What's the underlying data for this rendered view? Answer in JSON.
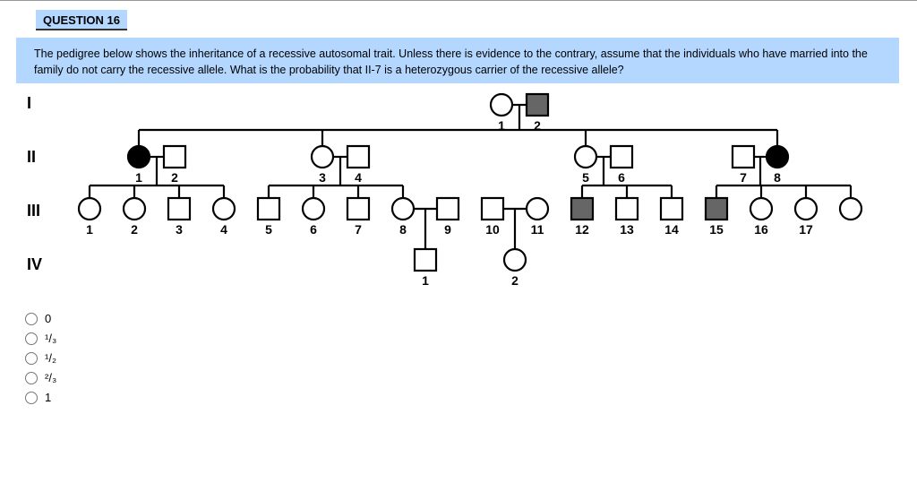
{
  "question": {
    "heading": "QUESTION 16",
    "text": "The pedigree below shows the inheritance of a recessive autosomal trait. Unless there is evidence to the contrary, assume that the individuals who have married into the family do not carry the recessive allele. What is the probability that II-7 is a heterozygous carrier of the recessive allele?"
  },
  "rows": {
    "r1": "I",
    "r2": "II",
    "r3": "III",
    "r4": "IV"
  },
  "people": {
    "i1": "1",
    "i2": "2",
    "ii1": "1",
    "ii2": "2",
    "ii3": "3",
    "ii4": "4",
    "ii5": "5",
    "ii6": "6",
    "ii7": "7",
    "ii8": "8",
    "iii1": "1",
    "iii2": "2",
    "iii3": "3",
    "iii4": "4",
    "iii5": "5",
    "iii6": "6",
    "iii7": "7",
    "iii8": "8",
    "iii9": "9",
    "iii10": "10",
    "iii11": "11",
    "iii12": "12",
    "iii13": "13",
    "iii14": "14",
    "iii15": "15",
    "iii16": "16",
    "iii17": "17",
    "iv1": "1",
    "iv2": "2"
  },
  "answers": {
    "a": "0",
    "b": "¹/₃",
    "c": "¹/₂",
    "d": "²/₃",
    "e": "1"
  }
}
